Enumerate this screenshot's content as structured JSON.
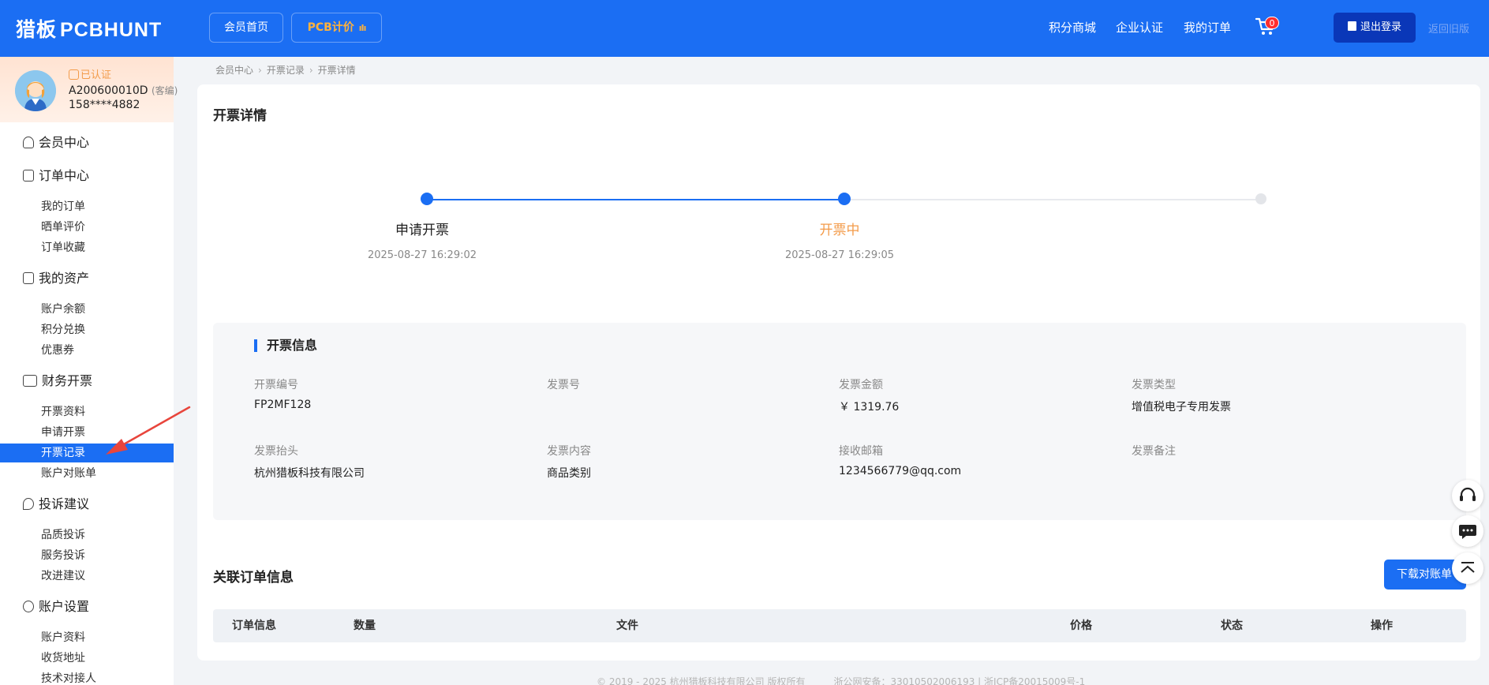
{
  "header": {
    "logo_cn": "猎板",
    "logo_en": "PCBHUNT",
    "home_btn": "会员首页",
    "pcb_btn": "PCB计价",
    "nav": {
      "points": "积分商城",
      "enterprise": "企业认证",
      "my_orders": "我的订单"
    },
    "cart_count": "0",
    "logout": "退出登录",
    "old_version": "返回旧版"
  },
  "user": {
    "cert_status": "已认证",
    "id": "A200600010D",
    "id_tag": "(客编)",
    "phone": "158****4882"
  },
  "sidebar": {
    "member_center": "会员中心",
    "order_center": {
      "title": "订单中心",
      "items": [
        "我的订单",
        "晒单评价",
        "订单收藏"
      ]
    },
    "assets": {
      "title": "我的资产",
      "items": [
        "账户余额",
        "积分兑换",
        "优惠券"
      ]
    },
    "finance": {
      "title": "财务开票",
      "items": [
        "开票资料",
        "申请开票",
        "开票记录",
        "账户对账单"
      ]
    },
    "complaint": {
      "title": "投诉建议",
      "items": [
        "品质投诉",
        "服务投诉",
        "改进建议"
      ]
    },
    "settings": {
      "title": "账户设置",
      "items": [
        "账户资料",
        "收货地址",
        "技术对接人"
      ]
    }
  },
  "breadcrumb": [
    "会员中心",
    "开票记录",
    "开票详情"
  ],
  "page_title": "开票详情",
  "steps": [
    {
      "label": "申请开票",
      "time": "2025-08-27 16:29:02",
      "state": "done"
    },
    {
      "label": "开票中",
      "time": "2025-08-27 16:29:05",
      "state": "current"
    },
    {
      "label": "",
      "time": "",
      "state": "pending"
    }
  ],
  "invoice_info": {
    "title": "开票信息",
    "fields": [
      {
        "label": "开票编号",
        "value": "FP2MF128"
      },
      {
        "label": "发票号",
        "value": ""
      },
      {
        "label": "发票金额",
        "value": "￥ 1319.76"
      },
      {
        "label": "发票类型",
        "value": "增值税电子专用发票"
      },
      {
        "label": "发票抬头",
        "value": "杭州猎板科技有限公司"
      },
      {
        "label": "发票内容",
        "value": "商品类别"
      },
      {
        "label": "接收邮箱",
        "value": "1234566779@qq.com"
      },
      {
        "label": "发票备注",
        "value": ""
      }
    ]
  },
  "related": {
    "title": "关联订单信息",
    "download_btn": "下载对账单",
    "columns": [
      "订单信息",
      "数量",
      "文件",
      "价格",
      "状态",
      "操作"
    ]
  },
  "footer": "© 2019 - 2025 杭州猎板科技有限公司 版权所有　　　浙公网安备：33010502006193 | 浙ICP备20015009号-1",
  "colors": {
    "primary": "#1b6ef3",
    "accent_orange": "#f39b4a",
    "logout_dark": "#0a37b8"
  }
}
